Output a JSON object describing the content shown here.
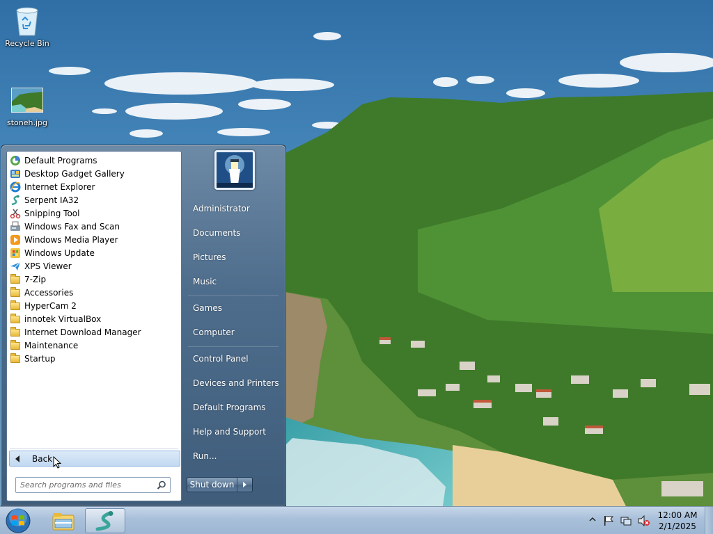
{
  "desktop": {
    "icons": [
      {
        "label": "Recycle Bin",
        "icon": "recycle-bin-icon"
      },
      {
        "label": "stoneh.jpg",
        "icon": "image-thumbnail-icon"
      }
    ]
  },
  "start_menu": {
    "programs": [
      {
        "label": "Default Programs",
        "icon": "default-programs-icon"
      },
      {
        "label": "Desktop Gadget Gallery",
        "icon": "gadget-gallery-icon"
      },
      {
        "label": "Internet Explorer",
        "icon": "internet-explorer-icon"
      },
      {
        "label": "Serpent IA32",
        "icon": "serpent-icon"
      },
      {
        "label": "Snipping Tool",
        "icon": "snipping-tool-icon"
      },
      {
        "label": "Windows Fax and Scan",
        "icon": "fax-scan-icon"
      },
      {
        "label": "Windows Media Player",
        "icon": "media-player-icon"
      },
      {
        "label": "Windows Update",
        "icon": "windows-update-icon"
      },
      {
        "label": "XPS Viewer",
        "icon": "xps-viewer-icon"
      },
      {
        "label": "7-Zip",
        "icon": "folder-icon"
      },
      {
        "label": "Accessories",
        "icon": "folder-icon"
      },
      {
        "label": "HyperCam 2",
        "icon": "folder-icon"
      },
      {
        "label": "innotek VirtualBox",
        "icon": "folder-icon"
      },
      {
        "label": "Internet Download Manager",
        "icon": "folder-icon"
      },
      {
        "label": "Maintenance",
        "icon": "folder-icon"
      },
      {
        "label": "Startup",
        "icon": "folder-icon"
      }
    ],
    "back_label": "Back",
    "search_placeholder": "Search programs and files",
    "right_items": [
      "Administrator",
      "Documents",
      "Pictures",
      "Music",
      "Games",
      "Computer",
      "Control Panel",
      "Devices and Printers",
      "Default Programs",
      "Help and Support",
      "Run..."
    ],
    "shutdown_label": "Shut down"
  },
  "taskbar": {
    "pinned": [
      {
        "icon": "windows-explorer-icon"
      },
      {
        "icon": "serpent-icon"
      }
    ],
    "tray_icons": [
      "show-hidden-icons-icon",
      "action-center-flag-icon",
      "network-icon",
      "volume-muted-icon"
    ],
    "clock_time": "12:00 AM",
    "clock_date": "2/1/2025"
  },
  "colors": {
    "start_menu_accent": "#4e6d8c",
    "taskbar": "#a9c0da",
    "hover_highlight": "#c2d9f1"
  }
}
